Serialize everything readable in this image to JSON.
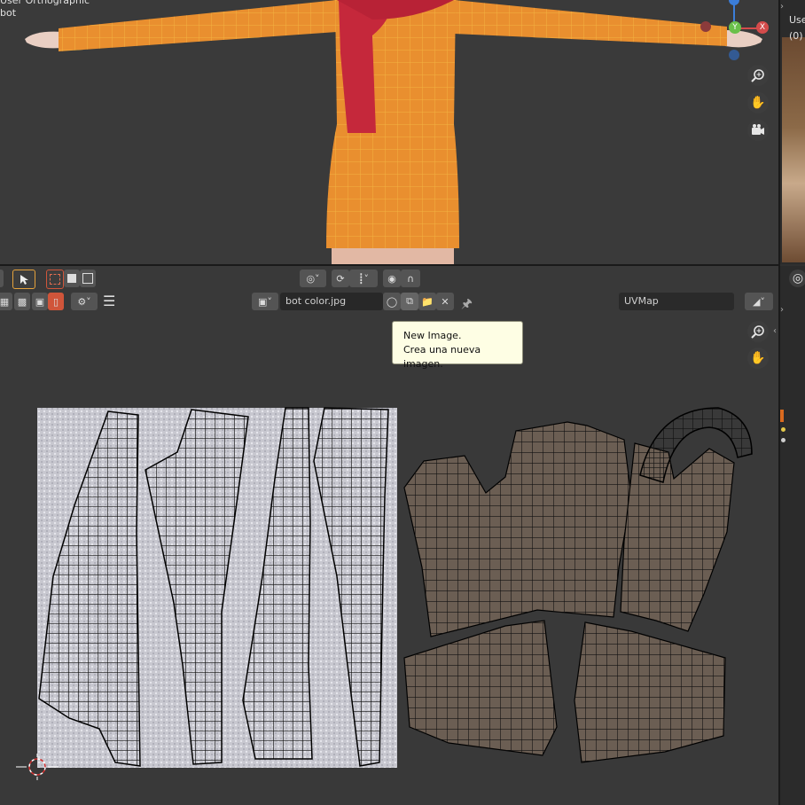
{
  "viewport_3d": {
    "view_label_line1": "User Orthographic",
    "view_label_line2": "bot",
    "gizmo": {
      "x_label": "X",
      "y_label": "Y"
    },
    "nav_icons": [
      "zoom-icon",
      "hand-pan-icon",
      "camera-icon"
    ]
  },
  "right_panel": {
    "text_line1": "Use",
    "text_line2": "(0)"
  },
  "uv_header": {
    "image_name": "bot color.jpg",
    "uv_map_name": "UVMap"
  },
  "tooltip": {
    "line1": "New Image.",
    "line2": "Crea una nueva imagen."
  },
  "colors": {
    "accent_selected": "#4772b3",
    "active_orange": "#d0553a",
    "tooltip_bg": "#fefee4",
    "sweater": "#e98f2f",
    "scarf": "#c5283b"
  }
}
